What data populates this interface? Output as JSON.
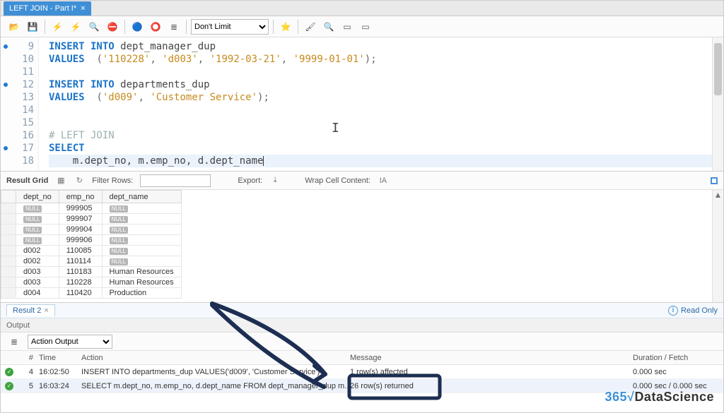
{
  "tab": {
    "title": "LEFT JOIN - Part I*"
  },
  "toolbar": {
    "limit_options": [
      "Don't Limit"
    ],
    "limit_selected": "Don't Limit"
  },
  "editor": {
    "lines": [
      {
        "n": 9,
        "dot": true,
        "seg": [
          [
            "kw",
            "INSERT INTO"
          ],
          [
            "sp",
            " "
          ],
          [
            "id",
            "dept_manager_dup"
          ]
        ]
      },
      {
        "n": 10,
        "dot": false,
        "seg": [
          [
            "kw",
            "VALUES"
          ],
          [
            "sp",
            "  "
          ],
          [
            "op",
            "("
          ],
          [
            "str",
            "'110228'"
          ],
          [
            "op",
            ", "
          ],
          [
            "str",
            "'d003'"
          ],
          [
            "op",
            ", "
          ],
          [
            "str",
            "'1992-03-21'"
          ],
          [
            "op",
            ", "
          ],
          [
            "str",
            "'9999-01-01'"
          ],
          [
            "op",
            ");"
          ]
        ]
      },
      {
        "n": 11,
        "dot": false,
        "seg": []
      },
      {
        "n": 12,
        "dot": true,
        "seg": [
          [
            "kw",
            "INSERT INTO"
          ],
          [
            "sp",
            " "
          ],
          [
            "id",
            "departments_dup"
          ]
        ]
      },
      {
        "n": 13,
        "dot": false,
        "seg": [
          [
            "kw",
            "VALUES"
          ],
          [
            "sp",
            "  "
          ],
          [
            "op",
            "("
          ],
          [
            "str",
            "'d009'"
          ],
          [
            "op",
            ", "
          ],
          [
            "str",
            "'Customer Service'"
          ],
          [
            "op",
            ");"
          ]
        ]
      },
      {
        "n": 14,
        "dot": false,
        "seg": []
      },
      {
        "n": 15,
        "dot": false,
        "seg": []
      },
      {
        "n": 16,
        "dot": false,
        "seg": [
          [
            "cmt",
            "# LEFT JOIN"
          ]
        ]
      },
      {
        "n": 17,
        "dot": true,
        "seg": [
          [
            "kw",
            "SELECT"
          ]
        ]
      },
      {
        "n": 18,
        "dot": false,
        "seg": [
          [
            "in",
            "    "
          ],
          [
            "id",
            "m.dept_no, m.emp_no, d.dept_name"
          ]
        ],
        "current": true,
        "caret": true
      }
    ]
  },
  "resbar": {
    "grid_label": "Result Grid",
    "filter_label": "Filter Rows:",
    "export_label": "Export:",
    "wrap_label": "Wrap Cell Content:"
  },
  "grid": {
    "columns": [
      "dept_no",
      "emp_no",
      "dept_name"
    ],
    "rows": [
      {
        "dept_no": null,
        "emp_no": "999905",
        "dept_name": null
      },
      {
        "dept_no": null,
        "emp_no": "999907",
        "dept_name": null
      },
      {
        "dept_no": null,
        "emp_no": "999904",
        "dept_name": null
      },
      {
        "dept_no": null,
        "emp_no": "999906",
        "dept_name": null
      },
      {
        "dept_no": "d002",
        "emp_no": "110085",
        "dept_name": null
      },
      {
        "dept_no": "d002",
        "emp_no": "110114",
        "dept_name": null
      },
      {
        "dept_no": "d003",
        "emp_no": "110183",
        "dept_name": "Human Resources"
      },
      {
        "dept_no": "d003",
        "emp_no": "110228",
        "dept_name": "Human Resources"
      },
      {
        "dept_no": "d004",
        "emp_no": "110420",
        "dept_name": "Production"
      }
    ]
  },
  "restabrow": {
    "tab_label": "Result 2",
    "readonly_label": "Read Only"
  },
  "output": {
    "header": "Output",
    "selector": "Action Output",
    "columns": {
      "num": "#",
      "time": "Time",
      "action": "Action",
      "msg": "Message",
      "dur": "Duration / Fetch"
    },
    "rows": [
      {
        "num": "4",
        "time": "16:02:50",
        "action": "INSERT INTO departments_dup  VALUES('d009', 'Customer Service')",
        "msg": "1 row(s) affected",
        "dur": "0.000 sec"
      },
      {
        "num": "5",
        "time": "16:03:24",
        "action": "SELECT    m.dept_no, m.emp_no, d.dept_name FROM    dept_manager_dup m...",
        "msg": "26 row(s) returned",
        "dur": "0.000 sec / 0.000 sec",
        "sel": true
      }
    ]
  },
  "watermark": {
    "brand1": "365",
    "brand2": "√",
    "brand3": "DataScience"
  },
  "icons": {
    "open": "📂",
    "save": "💾",
    "lightning": "⚡",
    "lightning2": "⚡",
    "magnify": "🔍",
    "stop": "⛔",
    "circle1": "🔵",
    "circle2": "⭕",
    "list": "≣",
    "star": "⭐",
    "brush": "🖌",
    "zoom": "🔍",
    "box1": "▭",
    "box2": "▭",
    "gridicon": "▦",
    "refresh": "↻",
    "exporticon": "⤓",
    "wrapicon": "IA",
    "listbtn": "≣"
  }
}
